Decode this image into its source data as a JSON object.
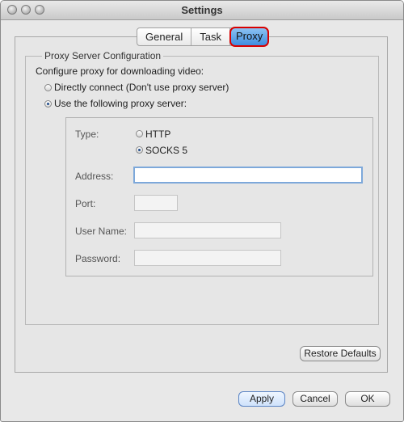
{
  "window": {
    "title": "Settings"
  },
  "tabs": [
    {
      "label": "General",
      "active": false
    },
    {
      "label": "Task",
      "active": false
    },
    {
      "label": "Proxy",
      "active": true
    }
  ],
  "proxy": {
    "section_title": "Proxy Server Configuration",
    "description": "Configure proxy for downloading video:",
    "direct_option": "Directly connect (Don't use proxy server)",
    "use_proxy_option": "Use the following proxy server:",
    "type_label": "Type:",
    "type_http": "HTTP",
    "type_socks": "SOCKS 5",
    "address_label": "Address:",
    "port_label": "Port:",
    "username_label": "User Name:",
    "password_label": "Password:",
    "address_value": "",
    "port_value": "",
    "username_value": "",
    "password_value": ""
  },
  "buttons": {
    "restore": "Restore Defaults",
    "apply": "Apply",
    "cancel": "Cancel",
    "ok": "OK"
  },
  "colors": {
    "highlight": "#d80000",
    "tab_active": "#4a93e4"
  }
}
